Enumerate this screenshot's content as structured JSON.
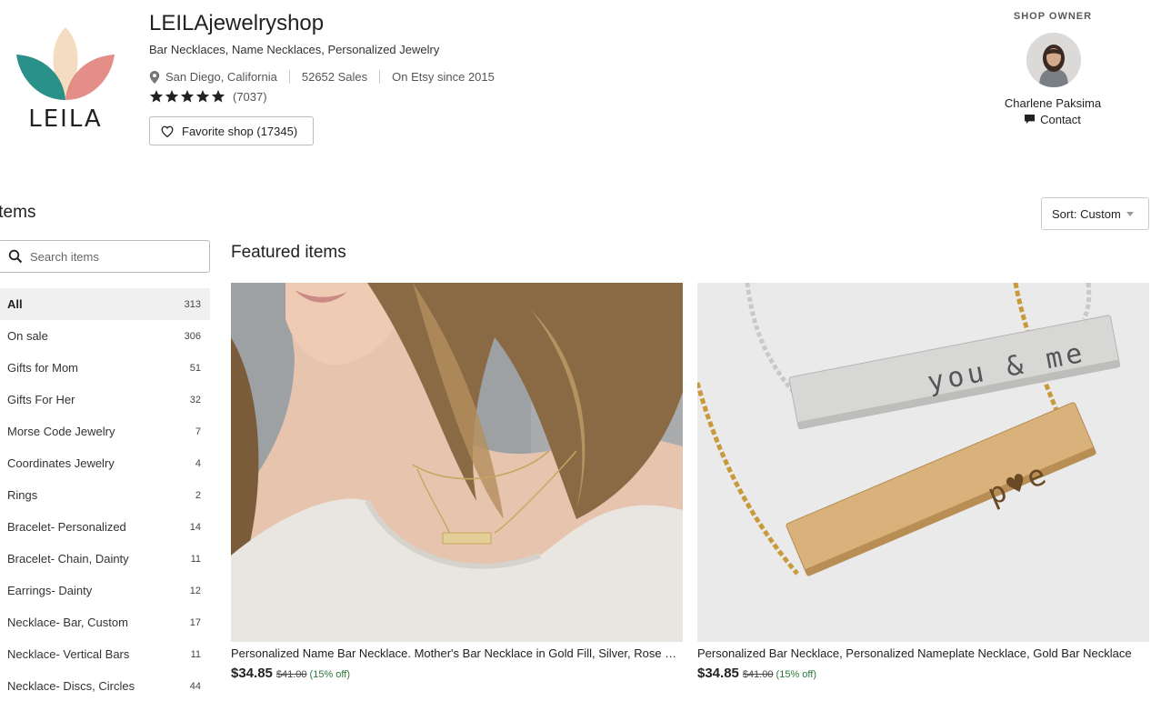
{
  "shop": {
    "logo_text": "LEILA",
    "name": "LEILAjewelryshop",
    "tagline": "Bar Necklaces, Name Necklaces, Personalized Jewelry",
    "location": "San Diego, California",
    "sales": "52652 Sales",
    "since": "On Etsy since 2015",
    "rating_stars": 5,
    "rating_count": "(7037)",
    "favorite_label": "Favorite shop (17345)"
  },
  "owner": {
    "heading": "SHOP OWNER",
    "name": "Charlene Paksima",
    "contact_label": "Contact"
  },
  "items": {
    "title": "Items",
    "sort_label": "Sort: Custom",
    "search_placeholder": "Search items",
    "featured_title": "Featured items",
    "categories": [
      {
        "label": "All",
        "count": "313"
      },
      {
        "label": "On sale",
        "count": "306"
      },
      {
        "label": "Gifts for Mom",
        "count": "51"
      },
      {
        "label": "Gifts For Her",
        "count": "32"
      },
      {
        "label": "Morse Code Jewelry",
        "count": "7"
      },
      {
        "label": "Coordinates Jewelry",
        "count": "4"
      },
      {
        "label": "Rings",
        "count": "2"
      },
      {
        "label": "Bracelet- Personalized",
        "count": "14"
      },
      {
        "label": "Bracelet- Chain, Dainty",
        "count": "11"
      },
      {
        "label": "Earrings- Dainty",
        "count": "12"
      },
      {
        "label": "Necklace- Bar, Custom",
        "count": "17"
      },
      {
        "label": "Necklace- Vertical Bars",
        "count": "11"
      },
      {
        "label": "Necklace- Discs, Circles",
        "count": "44"
      }
    ],
    "products": [
      {
        "title": "Personalized Name Bar Necklace. Mother's Bar Necklace in Gold Fill, Silver, Rose Gold",
        "price": "$34.85",
        "original_price": "$41.00",
        "discount": "(15% off)"
      },
      {
        "title": "Personalized Bar Necklace, Personalized Nameplate Necklace, Gold Bar Necklace",
        "price": "$34.85",
        "original_price": "$41.00",
        "discount": "(15% off)",
        "engraving_top": "you & me",
        "engraving_bottom": "p♥e"
      }
    ]
  },
  "colors": {
    "logo_teal": "#1f8a84",
    "logo_coral": "#e0837a",
    "logo_peach": "#f3dcc0",
    "discount_green": "#2b7a3d"
  }
}
